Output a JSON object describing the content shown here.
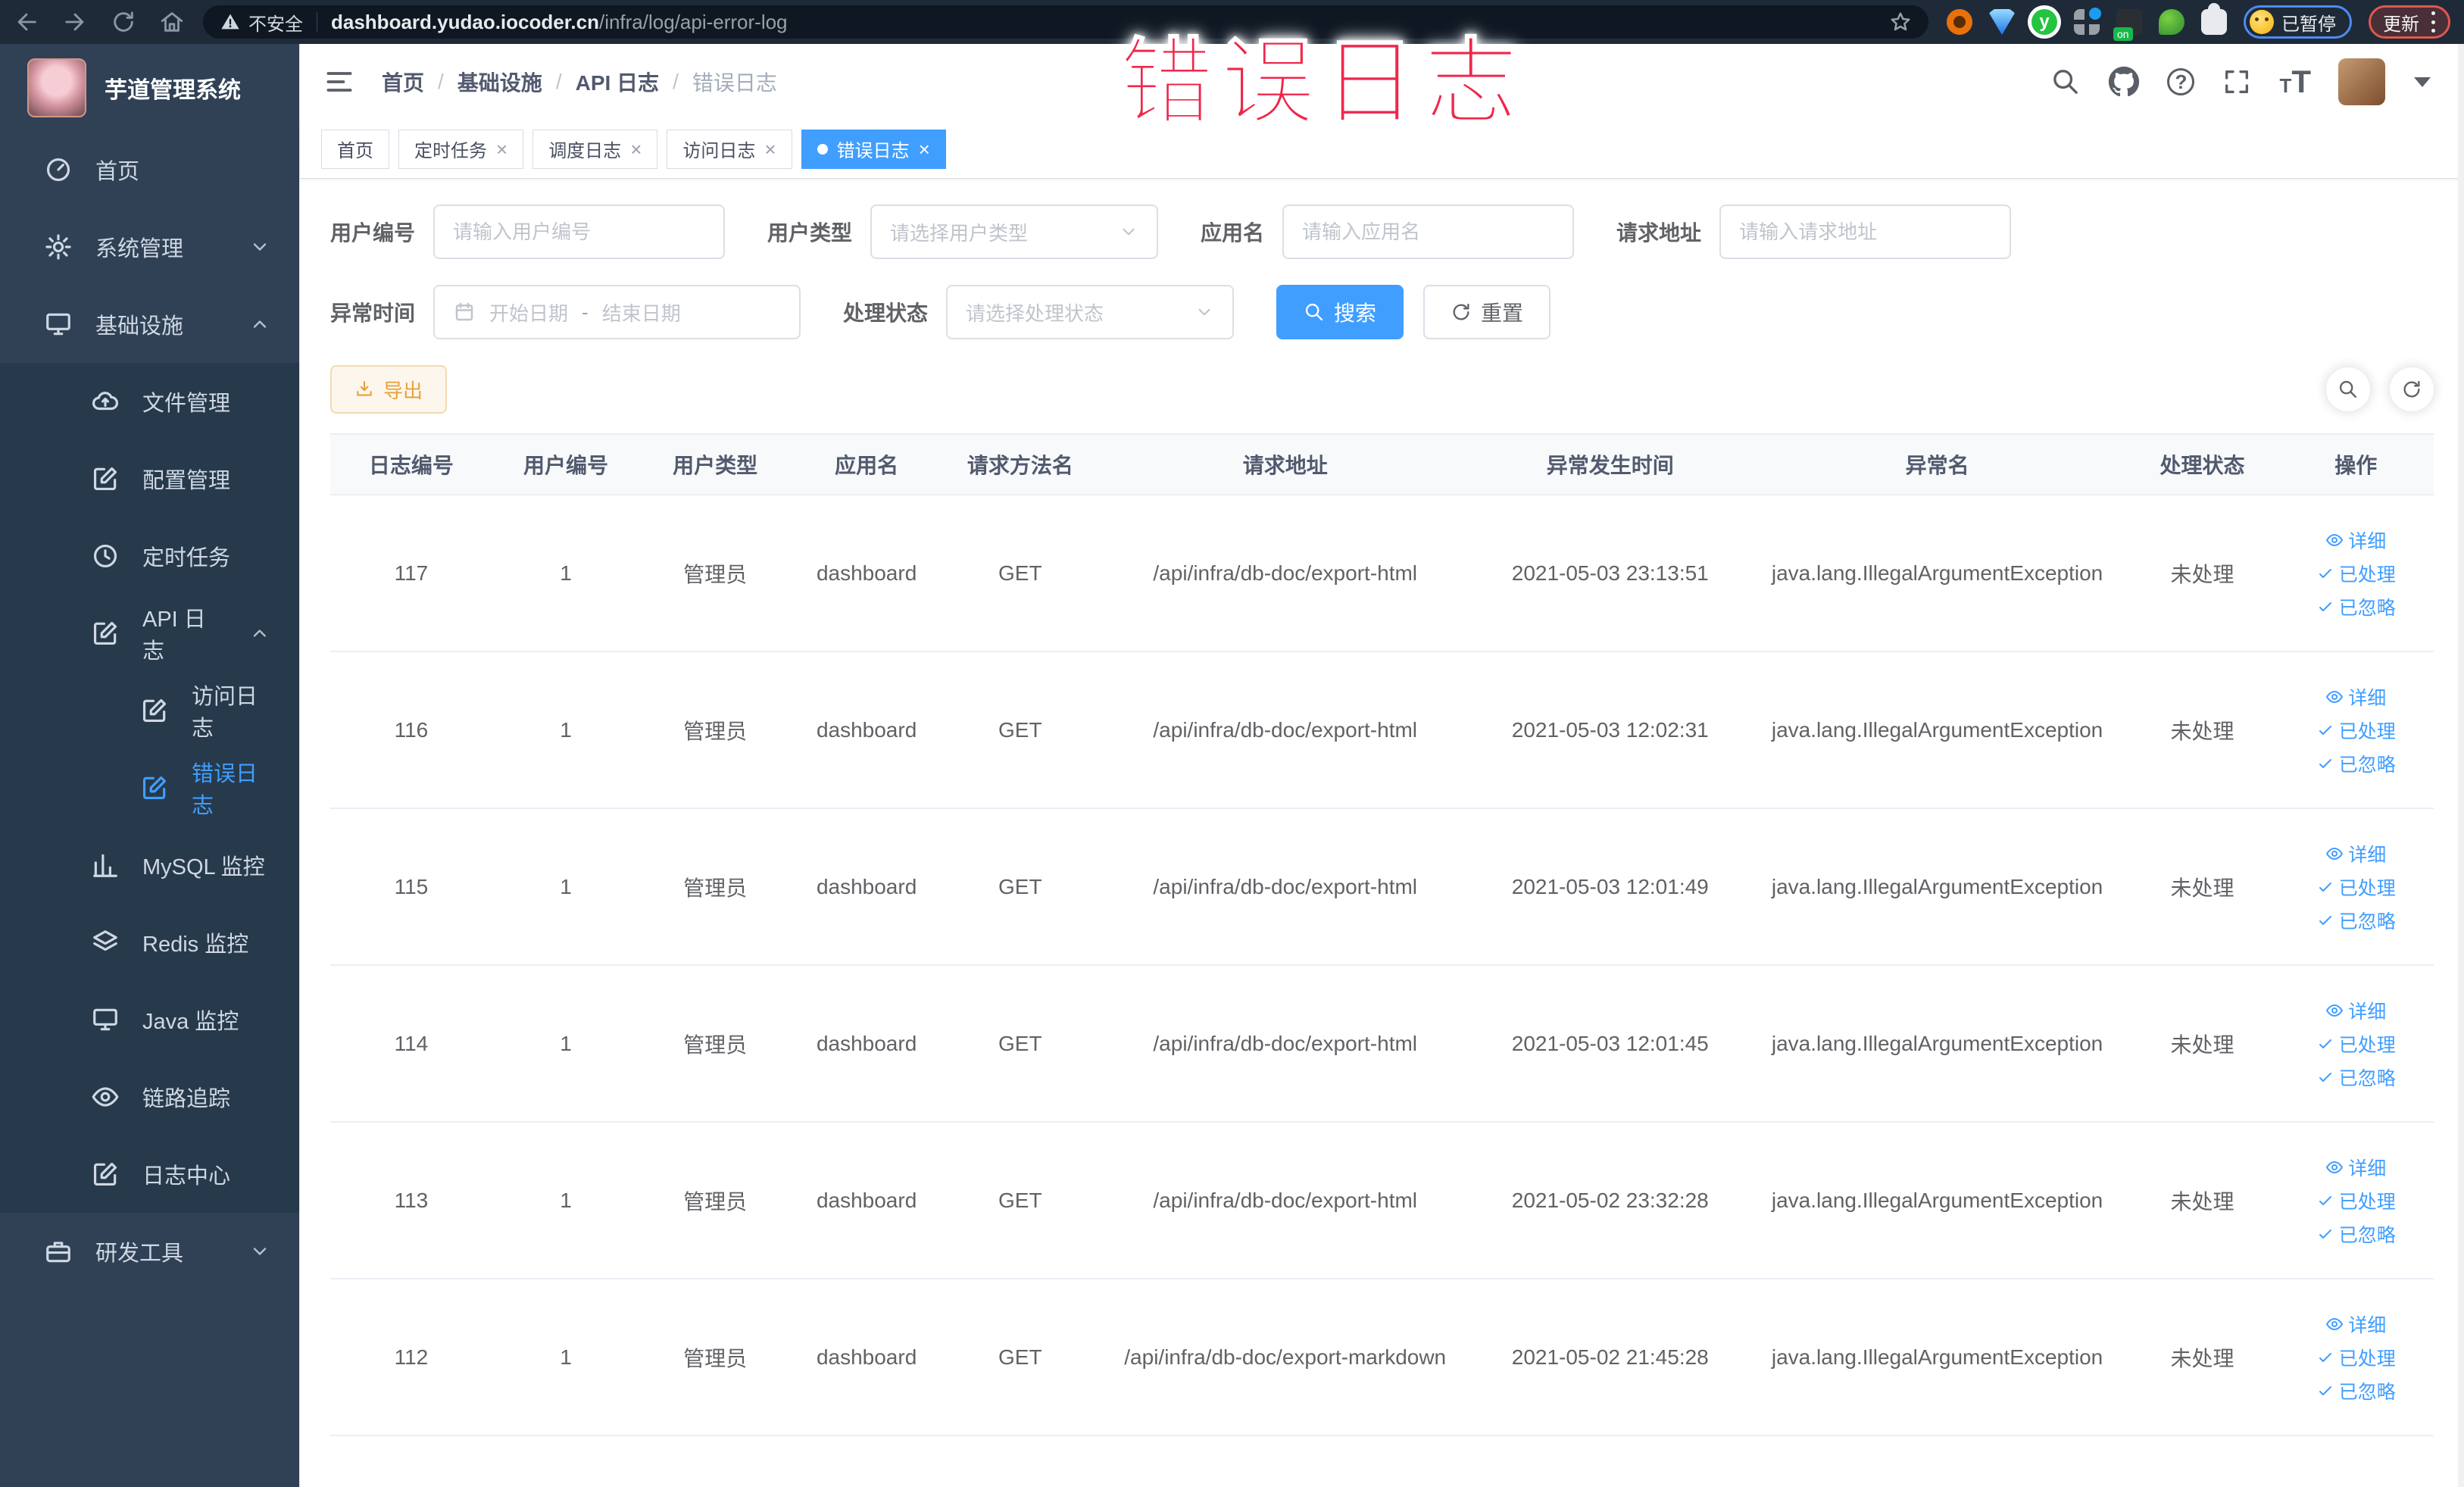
{
  "colors": {
    "accent": "#409eff",
    "warning": "#e6a23c",
    "annotation_red": "#f0264b",
    "sidebar_bg": "#304156"
  },
  "browser": {
    "security_label": "不安全",
    "url_domain": "dashboard.yudao.iocoder.cn",
    "url_path": "/infra/log/api-error-log",
    "profile_chip_label": "已暂停",
    "update_label": "更新"
  },
  "overlay": {
    "text": "错误日志"
  },
  "sidebar": {
    "title": "芋道管理系统",
    "items": [
      {
        "label": "首页"
      },
      {
        "label": "系统管理"
      },
      {
        "label": "基础设施"
      },
      {
        "label": "文件管理"
      },
      {
        "label": "配置管理"
      },
      {
        "label": "定时任务"
      },
      {
        "label": "API 日志"
      },
      {
        "label": "访问日志"
      },
      {
        "label": "错误日志"
      },
      {
        "label": "MySQL 监控"
      },
      {
        "label": "Redis 监控"
      },
      {
        "label": "Java 监控"
      },
      {
        "label": "链路追踪"
      },
      {
        "label": "日志中心"
      },
      {
        "label": "研发工具"
      }
    ]
  },
  "breadcrumb": [
    "首页",
    "基础设施",
    "API 日志",
    "错误日志"
  ],
  "tabs": [
    {
      "label": "首页"
    },
    {
      "label": "定时任务"
    },
    {
      "label": "调度日志"
    },
    {
      "label": "访问日志"
    },
    {
      "label": "错误日志"
    }
  ],
  "filters": {
    "user_id_label": "用户编号",
    "user_id_placeholder": "请输入用户编号",
    "user_type_label": "用户类型",
    "user_type_placeholder": "请选择用户类型",
    "app_label": "应用名",
    "app_placeholder": "请输入应用名",
    "url_label": "请求地址",
    "url_placeholder": "请输入请求地址",
    "time_label": "异常时间",
    "time_start_placeholder": "开始日期",
    "time_separator": "-",
    "time_end_placeholder": "结束日期",
    "status_label": "处理状态",
    "status_placeholder": "请选择处理状态",
    "search_label": "搜索",
    "reset_label": "重置"
  },
  "toolbar": {
    "export_label": "导出"
  },
  "table": {
    "headers": [
      "日志编号",
      "用户编号",
      "用户类型",
      "应用名",
      "请求方法名",
      "请求地址",
      "异常发生时间",
      "异常名",
      "处理状态",
      "操作"
    ],
    "actions": [
      "详细",
      "已处理",
      "已忽略"
    ],
    "rows": [
      {
        "id": "117",
        "user_id": "1",
        "user_type": "管理员",
        "app": "dashboard",
        "method": "GET",
        "url": "/api/infra/db-doc/export-html",
        "time": "2021-05-03 23:13:51",
        "exception": "java.lang.IllegalArgumentException",
        "status": "未处理"
      },
      {
        "id": "116",
        "user_id": "1",
        "user_type": "管理员",
        "app": "dashboard",
        "method": "GET",
        "url": "/api/infra/db-doc/export-html",
        "time": "2021-05-03 12:02:31",
        "exception": "java.lang.IllegalArgumentException",
        "status": "未处理"
      },
      {
        "id": "115",
        "user_id": "1",
        "user_type": "管理员",
        "app": "dashboard",
        "method": "GET",
        "url": "/api/infra/db-doc/export-html",
        "time": "2021-05-03 12:01:49",
        "exception": "java.lang.IllegalArgumentException",
        "status": "未处理"
      },
      {
        "id": "114",
        "user_id": "1",
        "user_type": "管理员",
        "app": "dashboard",
        "method": "GET",
        "url": "/api/infra/db-doc/export-html",
        "time": "2021-05-03 12:01:45",
        "exception": "java.lang.IllegalArgumentException",
        "status": "未处理"
      },
      {
        "id": "113",
        "user_id": "1",
        "user_type": "管理员",
        "app": "dashboard",
        "method": "GET",
        "url": "/api/infra/db-doc/export-html",
        "time": "2021-05-02 23:32:28",
        "exception": "java.lang.IllegalArgumentException",
        "status": "未处理"
      },
      {
        "id": "112",
        "user_id": "1",
        "user_type": "管理员",
        "app": "dashboard",
        "method": "GET",
        "url": "/api/infra/db-doc/export-markdown",
        "time": "2021-05-02 21:45:28",
        "exception": "java.lang.IllegalArgumentException",
        "status": "未处理"
      }
    ]
  }
}
